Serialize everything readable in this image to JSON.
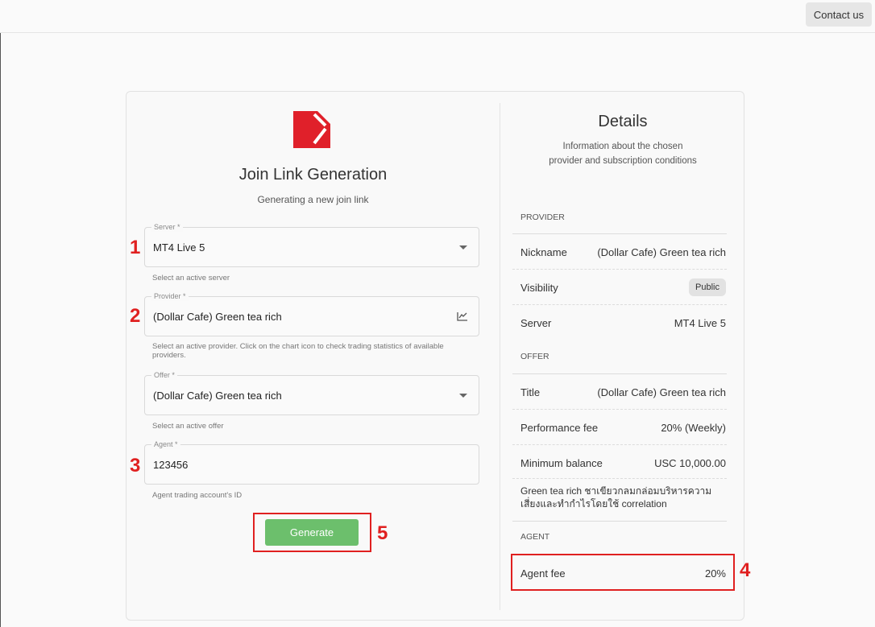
{
  "header": {
    "contact_label": "Contact us"
  },
  "form": {
    "title": "Join Link Generation",
    "subtitle": "Generating a new join link",
    "server": {
      "legend": "Server *",
      "value": "MT4 Live 5",
      "helper": "Select an active server"
    },
    "provider": {
      "legend": "Provider *",
      "value": "(Dollar Cafe) Green tea rich",
      "helper": "Select an active provider. Click on the chart icon to check trading statistics of available providers."
    },
    "offer": {
      "legend": "Offer *",
      "value": "(Dollar Cafe) Green tea rich",
      "helper": "Select an active offer"
    },
    "agent": {
      "legend": "Agent *",
      "value": "123456",
      "helper": "Agent trading account's ID"
    },
    "generate_label": "Generate"
  },
  "markers": {
    "m1": "1",
    "m2": "2",
    "m3": "3",
    "m4": "4",
    "m5": "5"
  },
  "details": {
    "title": "Details",
    "subtitle": "Information about the chosen provider and subscription conditions",
    "provider_section": "PROVIDER",
    "nickname_label": "Nickname",
    "nickname_value": "(Dollar Cafe) Green tea rich",
    "visibility_label": "Visibility",
    "visibility_value": "Public",
    "server_label": "Server",
    "server_value": "MT4 Live 5",
    "offer_section": "OFFER",
    "title_label": "Title",
    "title_value": "(Dollar Cafe) Green tea rich",
    "perf_fee_label": "Performance fee",
    "perf_fee_value": "20% (Weekly)",
    "min_balance_label": "Minimum balance",
    "min_balance_value": "USC 10,000.00",
    "offer_description": "Green tea rich ชาเขียวกลมกล่อมบริหารความเสี่ยงและทำกำไรโดยใช้ correlation",
    "agent_section": "AGENT",
    "agent_fee_label": "Agent fee",
    "agent_fee_value": "20%"
  },
  "colors": {
    "accent_green": "#6cbf6c",
    "logo_red": "#e0202a",
    "annotation_red": "#e02020"
  }
}
